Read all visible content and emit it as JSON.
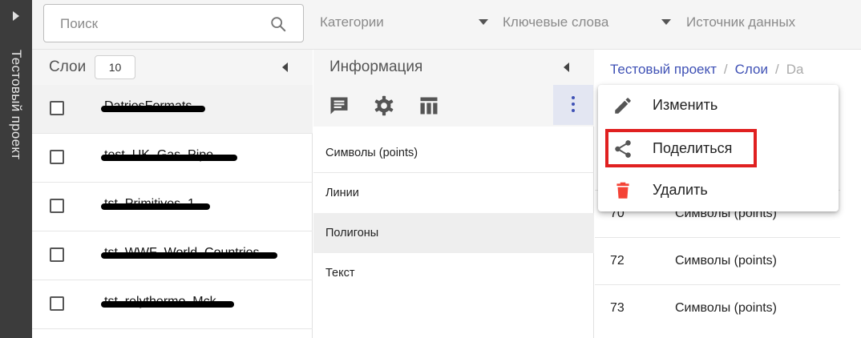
{
  "sidebar_rail": {
    "project_title": "Тестовый проект"
  },
  "topbar": {
    "search_placeholder": "Поиск",
    "filters": [
      "Категории",
      "Ключевые слова",
      "Источник данных"
    ]
  },
  "layers_panel": {
    "title": "Слои",
    "count": "10",
    "items": [
      {
        "name": "DatriesFormats",
        "selected": true,
        "redacted": true
      },
      {
        "name": "test_UK_Gas_Pipe",
        "selected": false,
        "redacted": true
      },
      {
        "name": "tst_Primitives_1",
        "selected": false,
        "redacted": true
      },
      {
        "name": "tst_WWF_World_Countries",
        "selected": false,
        "redacted": true
      },
      {
        "name": "tst_relythermo_Mck",
        "selected": false,
        "redacted": true
      }
    ]
  },
  "info_panel": {
    "title": "Информация",
    "tools": [
      "comment-icon",
      "gear-icon",
      "table-icon"
    ],
    "items": [
      "Символы (points)",
      "Линии",
      "Полигоны",
      "Текст"
    ],
    "active_item": "Полигоны"
  },
  "breadcrumb": {
    "items": [
      "Тестовый проект",
      "Слои"
    ],
    "current": "Da"
  },
  "data_rows": [
    {
      "num": "70",
      "value": "Символы (points)"
    },
    {
      "num": "72",
      "value": "Символы (points)"
    },
    {
      "num": "73",
      "value": "Символы (points)"
    }
  ],
  "context_menu": {
    "items": [
      {
        "label": "Изменить",
        "icon": "pencil-icon"
      },
      {
        "label": "Поделиться",
        "icon": "share-icon",
        "highlighted": true
      },
      {
        "label": "Удалить",
        "icon": "trash-icon"
      }
    ]
  },
  "colors": {
    "rail": "#3c3c3c",
    "accent": "#3f51b5",
    "delete": "#f44336",
    "highlight_box": "#e02020"
  }
}
